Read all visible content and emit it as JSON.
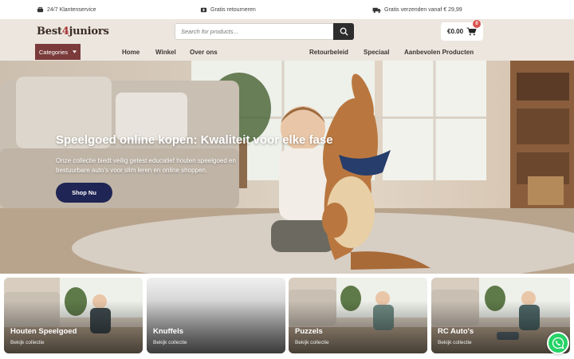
{
  "topbar": {
    "service": "24/7 Klantenservice",
    "returns": "Gratis retourneren",
    "shipping": "Gratis verzenden vanaf € 29,99"
  },
  "header": {
    "logo_part1": "Best",
    "logo_num": "4",
    "logo_part2": "juniors",
    "search_placeholder": "Search for products...",
    "cart_total": "€0.00",
    "cart_count": "0",
    "categories_label": "Categories"
  },
  "nav": {
    "home": "Home",
    "winkel": "Winkel",
    "over": "Over ons",
    "retour": "Retourbeleid",
    "speciaal": "Speciaal",
    "aanbevolen": "Aanbevolen Producten"
  },
  "hero": {
    "title": "Speelgoed online kopen: Kwaliteit voor elke fase",
    "text": "Onze collectie biedt veilig getest educatief houten speelgoed en bestuurbare auto's voor slim leren en online shoppen.",
    "button": "Shop Nu"
  },
  "cards": [
    {
      "title": "Houten Speelgoed",
      "link": "Bekijk collectie"
    },
    {
      "title": "Knuffels",
      "link": "Bekijk collectie"
    },
    {
      "title": "Puzzels",
      "link": "Bekijk collectie"
    },
    {
      "title": "RC Auto's",
      "link": "Bekijk collectie"
    }
  ],
  "colors": {
    "header_bg": "#ece6df",
    "categories_bg": "#7a3b3a",
    "button_bg": "#1f2554",
    "badge": "#d9534f",
    "whatsapp": "#25d366"
  }
}
